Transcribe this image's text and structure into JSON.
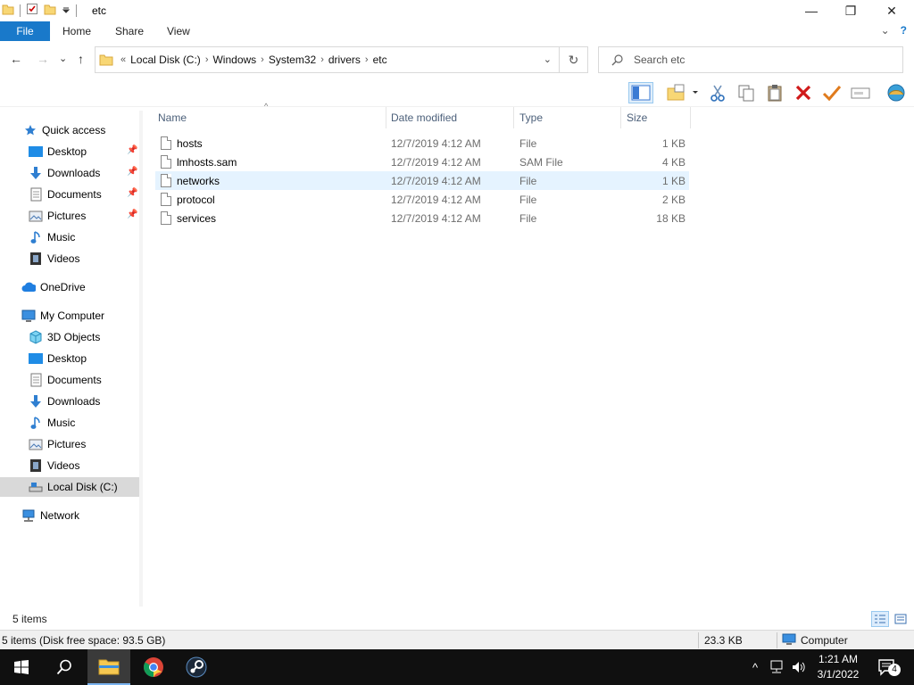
{
  "window": {
    "title": "etc",
    "minimize_glyph": "—",
    "restore_glyph": "❐",
    "close_glyph": "✕"
  },
  "ribbon": {
    "tabs": [
      "File",
      "Home",
      "Share",
      "View"
    ],
    "expand_glyph": "⌄",
    "help_glyph": "?"
  },
  "nav": {
    "back_glyph": "←",
    "forward_glyph": "→",
    "recent_glyph": "⌄",
    "up_glyph": "↑",
    "address_overflow": "«",
    "breadcrumb": [
      "Local Disk (C:)",
      "Windows",
      "System32",
      "drivers",
      "etc"
    ],
    "address_drop_glyph": "⌄",
    "refresh_glyph": "↻",
    "search_placeholder": "Search etc"
  },
  "toolbar": {
    "icons": [
      "preview-pane-icon",
      "new-folder-icon",
      "cut-icon",
      "copy-icon",
      "paste-icon",
      "delete-icon",
      "check-icon",
      "rename-icon",
      "web-icon"
    ]
  },
  "sidebar": {
    "items": [
      {
        "label": "Quick access",
        "icon": "star-icon",
        "level": 0
      },
      {
        "label": "Desktop",
        "icon": "desktop-icon",
        "level": 1,
        "pinned": true
      },
      {
        "label": "Downloads",
        "icon": "download-icon",
        "level": 1,
        "pinned": true
      },
      {
        "label": "Documents",
        "icon": "documents-icon",
        "level": 1,
        "pinned": true
      },
      {
        "label": "Pictures",
        "icon": "pictures-icon",
        "level": 1,
        "pinned": true
      },
      {
        "label": "Music",
        "icon": "music-icon",
        "level": 1
      },
      {
        "label": "Videos",
        "icon": "videos-icon",
        "level": 1
      },
      {
        "label": "OneDrive",
        "icon": "cloud-icon",
        "level": 0
      },
      {
        "label": "My Computer",
        "icon": "computer-icon",
        "level": 0
      },
      {
        "label": "3D Objects",
        "icon": "cube-icon",
        "level": 1
      },
      {
        "label": "Desktop",
        "icon": "desktop-icon",
        "level": 1
      },
      {
        "label": "Documents",
        "icon": "documents-icon",
        "level": 1
      },
      {
        "label": "Downloads",
        "icon": "download-icon",
        "level": 1
      },
      {
        "label": "Music",
        "icon": "music-icon",
        "level": 1
      },
      {
        "label": "Pictures",
        "icon": "pictures-icon",
        "level": 1
      },
      {
        "label": "Videos",
        "icon": "videos-icon",
        "level": 1
      },
      {
        "label": "Local Disk (C:)",
        "icon": "drive-icon",
        "level": 1,
        "selected": true
      },
      {
        "label": "Network",
        "icon": "network-icon",
        "level": 0
      }
    ],
    "pin_glyph": "📌"
  },
  "files": {
    "columns": [
      "Name",
      "Date modified",
      "Type",
      "Size"
    ],
    "sort_glyph": "^",
    "rows": [
      {
        "name": "hosts",
        "date": "12/7/2019 4:12 AM",
        "type": "File",
        "size": "1 KB"
      },
      {
        "name": "lmhosts.sam",
        "date": "12/7/2019 4:12 AM",
        "type": "SAM File",
        "size": "4 KB"
      },
      {
        "name": "networks",
        "date": "12/7/2019 4:12 AM",
        "type": "File",
        "size": "1 KB",
        "hover": true
      },
      {
        "name": "protocol",
        "date": "12/7/2019 4:12 AM",
        "type": "File",
        "size": "2 KB"
      },
      {
        "name": "services",
        "date": "12/7/2019 4:12 AM",
        "type": "File",
        "size": "18 KB"
      }
    ]
  },
  "status": {
    "item_count": "5 items",
    "details": "5 items (Disk free space: 93.5 GB)",
    "size": "23.3 KB",
    "location": "Computer"
  },
  "taskbar": {
    "tray_up_glyph": "^",
    "time": "1:21 AM",
    "date": "3/1/2022",
    "notification_count": "4"
  },
  "colors": {
    "accent": "#1979ca",
    "hover_row": "#e5f3ff",
    "selected_nav": "#d9d9d9",
    "taskbar": "#101010"
  }
}
